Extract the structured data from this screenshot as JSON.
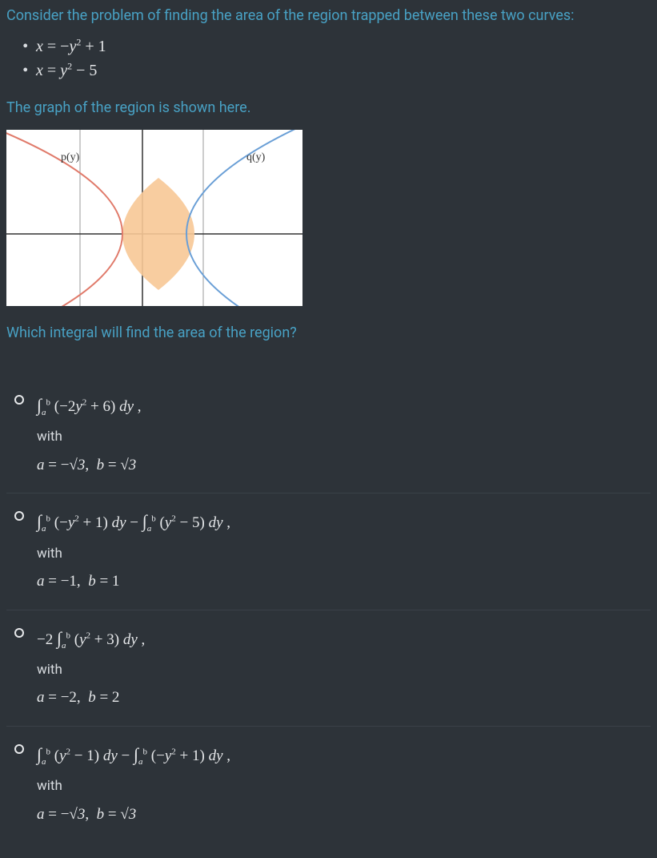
{
  "intro": "Consider the problem of finding the area of the region trapped between these two curves:",
  "curves": {
    "c1": "x = −y² + 1",
    "c2": "x = y² − 5"
  },
  "graph_caption": "The graph of the region is shown here.",
  "graph": {
    "p_label": "p(y)",
    "q_label": "q(y)"
  },
  "question": "Which integral will find the area of the region?",
  "options": {
    "o1": {
      "integral_html": "∫<sub>a</sub><sup>b</sup> (−2y² + 6) dy ,",
      "with": "with",
      "bounds_html": "a = −√3,  b = √3"
    },
    "o2": {
      "integral_html": "∫<sub>a</sub><sup>b</sup> (−y² + 1) dy − ∫<sub>a</sub><sup>b</sup> (y² − 5) dy ,",
      "with": "with",
      "bounds_html": "a = −1,  b = 1"
    },
    "o3": {
      "integral_html": "−2 ∫<sub>a</sub><sup>b</sup> (y² + 3) dy ,",
      "with": "with",
      "bounds_html": "a = −2,  b = 2"
    },
    "o4": {
      "integral_html": "∫<sub>a</sub><sup>b</sup> (y² − 1) dy − ∫<sub>a</sub><sup>b</sup> (−y² + 1) dy ,",
      "with": "with",
      "bounds_html": "a = −√3,  b = √3"
    }
  },
  "chart_data": {
    "type": "line",
    "title": "",
    "xlabel": "",
    "ylabel": "",
    "series": [
      {
        "name": "p(y)",
        "color": "#e07a6a",
        "equation": "x = -y^2 + 1"
      },
      {
        "name": "q(y)",
        "color": "#6a9fd6",
        "equation": "x = y^2 - 5"
      }
    ],
    "x_range": [
      -8,
      4
    ],
    "y_range": [
      -3,
      3
    ],
    "shaded_region": "between curves for -√3 ≤ y ≤ √3"
  }
}
